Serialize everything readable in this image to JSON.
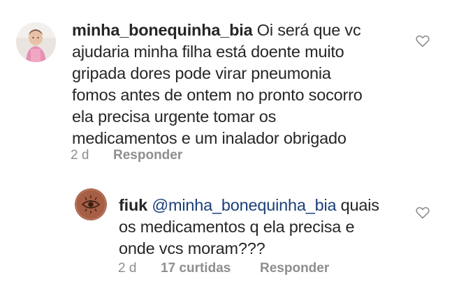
{
  "comments": [
    {
      "username": "minha_bonequinha_bia",
      "text": " Oi será que vc ajudaria minha filha está doente muito gripada dores pode virar  pneumonia fomos antes de ontem  no pronto socorro ela precisa urgente tomar os medicamentos e um inalador obrigado",
      "time": "2 d",
      "reply_label": "Responder",
      "avatar_icon": "child-photo-avatar",
      "like_icon": "heart-outline-icon"
    }
  ],
  "replies": [
    {
      "username": "fiuk",
      "mention": "@minha_bonequinha_bia",
      "text": " quais os medicamentos q ela precisa e onde vcs moram???",
      "time": "2 d",
      "likes": "17 curtidas",
      "reply_label": "Responder",
      "avatar_icon": "eye-emblem-avatar",
      "like_icon": "heart-outline-icon"
    }
  ],
  "colors": {
    "text": "#262626",
    "meta": "#8e8e8e",
    "mention": "#1a3f78",
    "fiuk_avatar_bg": "#a65e44"
  }
}
